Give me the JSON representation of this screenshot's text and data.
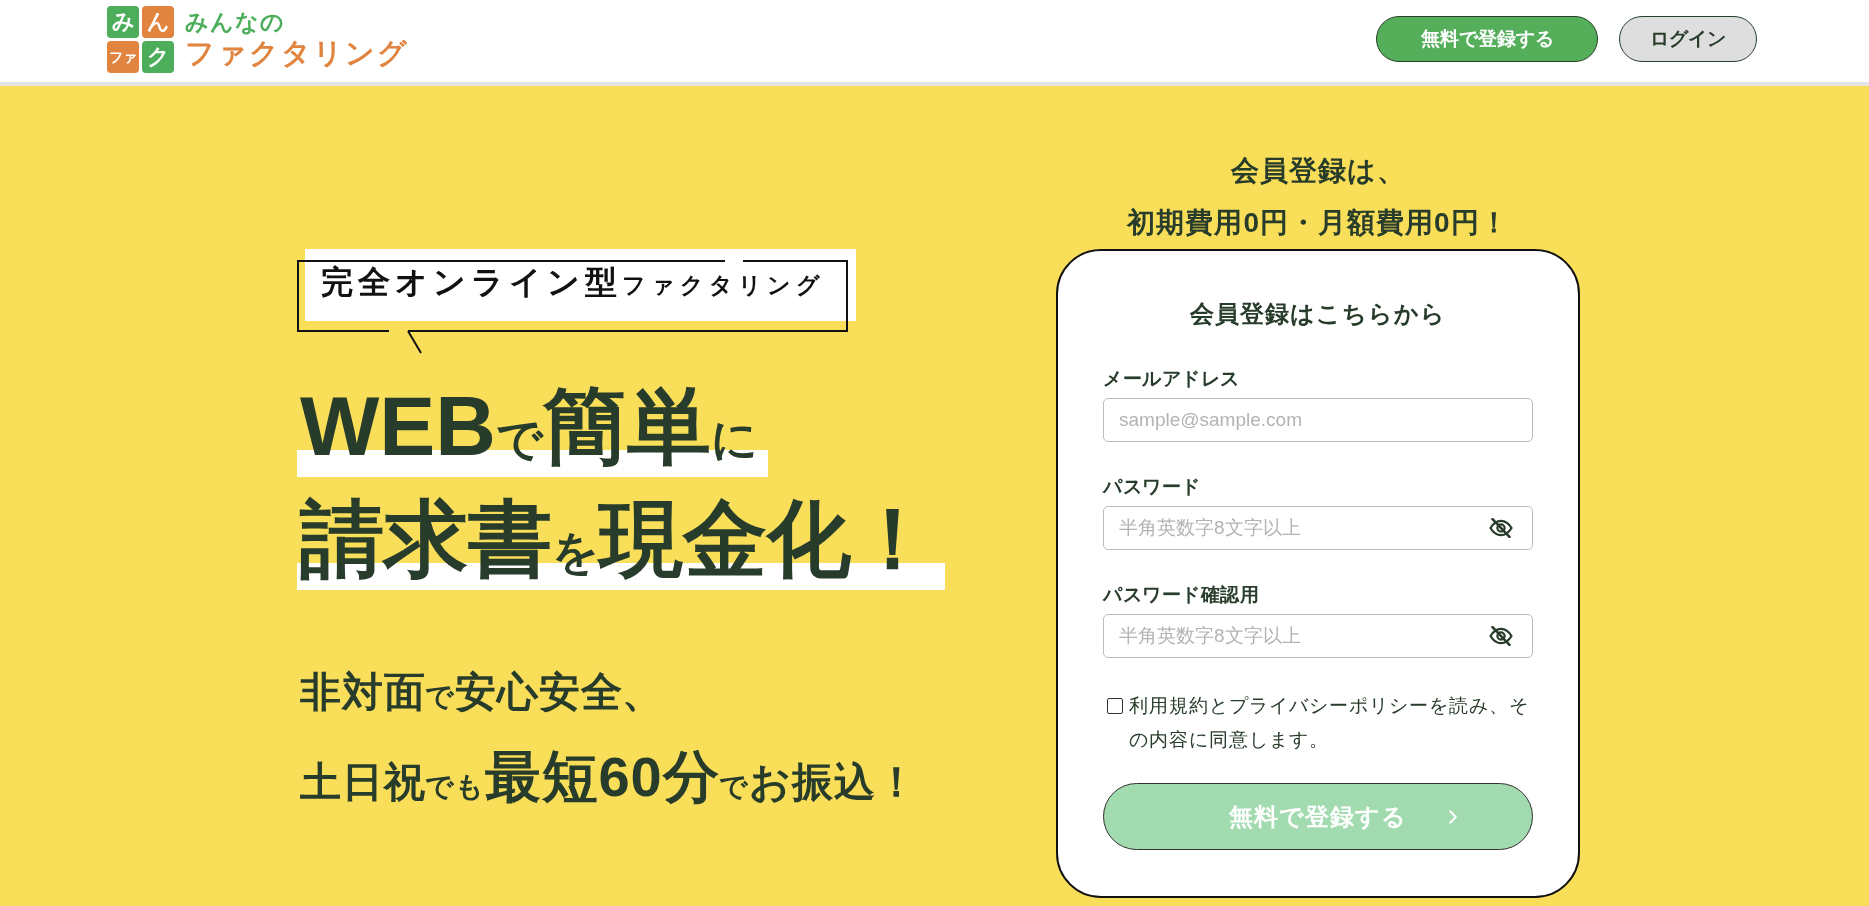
{
  "header": {
    "logo": {
      "tiles": [
        {
          "text": "み",
          "color": "#4cae5a"
        },
        {
          "text": "ん",
          "color": "#e0843f"
        },
        {
          "text": "ファ",
          "color": "#e0843f"
        },
        {
          "text": "ク",
          "color": "#4cae5a"
        }
      ],
      "title_top": "みんなの",
      "title_bottom": "ファクタリング"
    },
    "buttons": [
      {
        "label": "無料で登録する",
        "kind": "primary"
      },
      {
        "label": "ログイン",
        "kind": "secondary"
      }
    ]
  },
  "hero": {
    "tagline": [
      {
        "text": "完全オンライン型",
        "kind": "large"
      },
      {
        "text": "ファクタリング",
        "kind": "small"
      }
    ],
    "headline": [
      {
        "segments": [
          {
            "text": "WEB",
            "kind": "large"
          },
          {
            "text": "で",
            "kind": "small"
          },
          {
            "text": "簡単",
            "kind": "large"
          },
          {
            "text": "に",
            "kind": "small"
          }
        ]
      },
      {
        "segments": [
          {
            "text": "請求書",
            "kind": "large"
          },
          {
            "text": "を",
            "kind": "small"
          },
          {
            "text": "現金化！",
            "kind": "large"
          }
        ]
      }
    ],
    "subtitle": [
      {
        "segments": [
          {
            "text": "非対面",
            "kind": "medium"
          },
          {
            "text": "で",
            "kind": "small"
          },
          {
            "text": "安心安全、",
            "kind": "medium"
          }
        ]
      },
      {
        "segments": [
          {
            "text": "土日祝",
            "kind": "medium"
          },
          {
            "text": "でも",
            "kind": "small"
          },
          {
            "text": "最短60分",
            "kind": "large"
          },
          {
            "text": "で",
            "kind": "small"
          },
          {
            "text": "お振込！",
            "kind": "medium"
          }
        ]
      }
    ]
  },
  "signup": {
    "intro": [
      "会員登録は、",
      "初期費用0円・月額費用0円！"
    ],
    "form": {
      "title": "会員登録はこちらから",
      "fields": [
        {
          "label": "メールアドレス",
          "placeholder": "sample@sample.com",
          "kind": "email"
        },
        {
          "label": "パスワード",
          "placeholder": "半角英数字8文字以上",
          "kind": "password"
        },
        {
          "label": "パスワード確認用",
          "placeholder": "半角英数字8文字以上",
          "kind": "password"
        }
      ],
      "agreement": {
        "text": "利用規約とプライバシーポリシーを読み、その内容に同意します。",
        "checked": false
      },
      "submit": {
        "label": "無料で登録する",
        "disabled": true
      }
    }
  }
}
